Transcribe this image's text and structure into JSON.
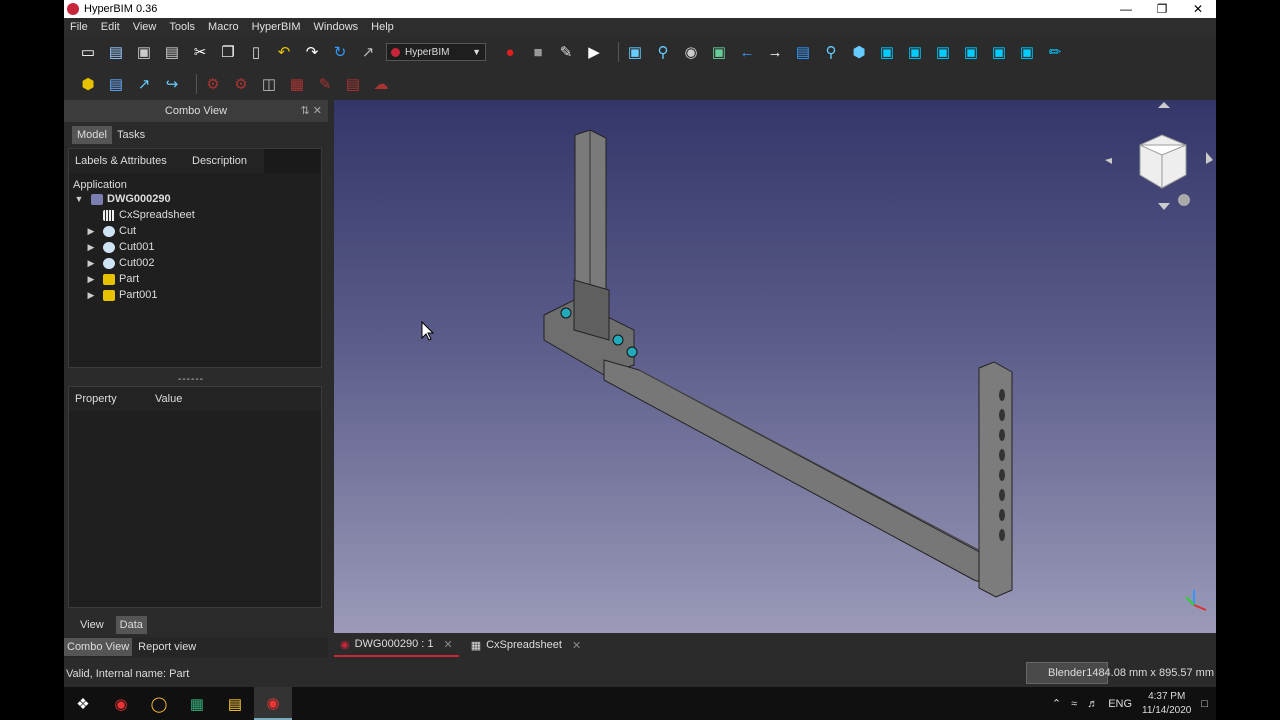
{
  "window": {
    "title": "HyperBIM 0.36",
    "minimize": "—",
    "restore": "❐",
    "close": "✕"
  },
  "menu": [
    "File",
    "Edit",
    "View",
    "Tools",
    "Macro",
    "HyperBIM",
    "Windows",
    "Help"
  ],
  "toolbar": {
    "workbench": "HyperBIM"
  },
  "combo_view": {
    "title": "Combo View",
    "tabs": [
      "Model",
      "Tasks"
    ],
    "tree_headers": [
      "Labels & Attributes",
      "Description"
    ],
    "application_label": "Application",
    "document": "DWG000290",
    "items": [
      {
        "label": "CxSpreadsheet",
        "icon": "spreadsheet-icon",
        "expandable": false
      },
      {
        "label": "Cut",
        "icon": "cut-icon",
        "expandable": true
      },
      {
        "label": "Cut001",
        "icon": "cut-icon",
        "expandable": true
      },
      {
        "label": "Cut002",
        "icon": "cut-icon",
        "expandable": true
      },
      {
        "label": "Part",
        "icon": "part-icon",
        "expandable": true
      },
      {
        "label": "Part001",
        "icon": "part-check-icon",
        "expandable": true
      }
    ],
    "splitter": "------",
    "property_headers": [
      "Property",
      "Value"
    ],
    "bottom_tabs": [
      "View",
      "Data"
    ],
    "lower_tabs": [
      "Combo View",
      "Report view"
    ]
  },
  "viewport": {
    "tabs": [
      "DWG000290 : 1",
      "CxSpreadsheet"
    ]
  },
  "status": {
    "text": "Valid, Internal name: Part",
    "nav_style": "Blender",
    "dimensions": "1484.08 mm x 895.57 mm"
  },
  "taskbar": {
    "lang": "ENG",
    "time": "4:37 PM",
    "date": "11/14/2020"
  },
  "colors": {
    "accent": "#c8243a",
    "viewport_top": "#333669",
    "viewport_bottom": "#9b9ab8"
  }
}
